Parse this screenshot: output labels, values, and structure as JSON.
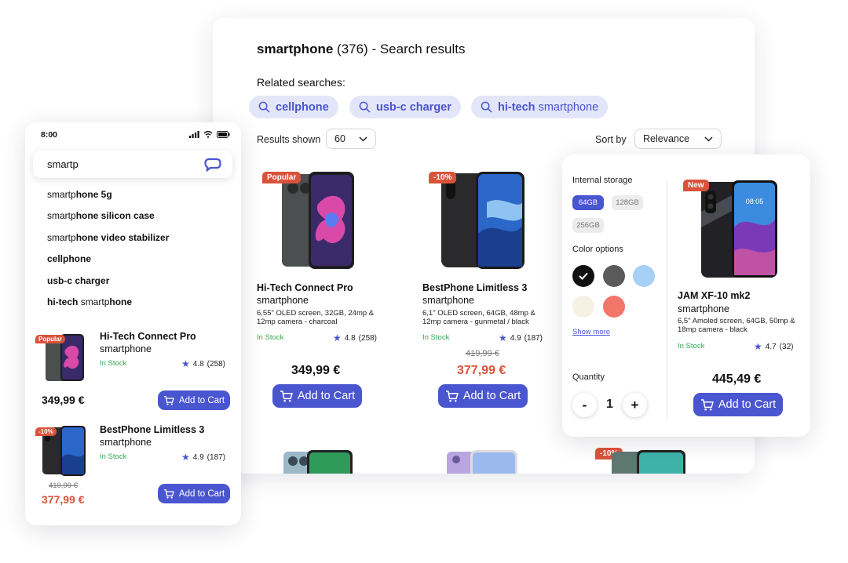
{
  "search": {
    "query": "smartphone",
    "count": "(376)",
    "suffix": "- Search results",
    "related_label": "Related searches:",
    "related": [
      {
        "query": "cellphone",
        "rest": ""
      },
      {
        "query": "usb-c charger",
        "rest": ""
      },
      {
        "query": "hi-tech",
        "rest": "smartphone"
      }
    ],
    "results_shown_label": "Results shown",
    "results_shown_value": "60",
    "sort_by_label": "Sort by",
    "sort_by_value": "Relevance"
  },
  "products": [
    {
      "badge": "Popular",
      "name": "Hi-Tech Connect Pro",
      "category": "smartphone",
      "desc": "6,55\" OLED screen, 32GB, 24mp & 12mp camera - charcoal",
      "stock": "In Stock",
      "rating": "4.8",
      "reviews": "(258)",
      "price": "349,99 €",
      "old_price": "",
      "cart_label": "Add to Cart"
    },
    {
      "badge": "-10%",
      "name": "BestPhone Limitless 3",
      "category": "smartphone",
      "desc": "6,1\" OLED screen, 64GB, 48mp & 12mp camera - gunmetal / black",
      "stock": "In Stock",
      "rating": "4.9",
      "reviews": "(187)",
      "price": "377,99 €",
      "old_price": "419,99 €",
      "cart_label": "Add to Cart"
    },
    {
      "badge": "New",
      "name": "JAM XF-10 mk2",
      "category": "smartphone",
      "desc": "6,5\" Amoled screen, 64GB, 50mp & 18mp camera - black",
      "stock": "In Stock",
      "rating": "4.7",
      "reviews": "(32)",
      "price": "445,49 €",
      "old_price": "",
      "cart_label": "Add to Cart",
      "screen_time": "08:05"
    }
  ],
  "row2_badge": "-10%",
  "mobile": {
    "time": "8:00",
    "search_value": "smartp",
    "suggestions": [
      {
        "typed": "smartp",
        "rest": "hone 5g",
        "extra": ""
      },
      {
        "typed": "smartp",
        "rest": "hone silicon case",
        "extra": ""
      },
      {
        "typed": "smartp",
        "rest": "hone video stabilizer",
        "extra": ""
      },
      {
        "typed": "",
        "rest": "cellphone",
        "extra": ""
      },
      {
        "typed": "",
        "rest": "usb-c charger",
        "extra": ""
      },
      {
        "typed": "smartp",
        "rest": "hone",
        "extra": "hi-tech"
      }
    ]
  },
  "filters": {
    "storage_label": "Internal storage",
    "storage_options": [
      "64GB",
      "128GB",
      "256GB"
    ],
    "color_label": "Color options",
    "colors": [
      "#111111",
      "#5a5a5a",
      "#a6d0f5",
      "#f6f1e3",
      "#f2766a"
    ],
    "show_more": "Show more",
    "quantity_label": "Quantity",
    "quantity_value": "1",
    "minus": "-",
    "plus": "+"
  },
  "colors": {
    "accent": "#4a55d0",
    "sale": "#d9533b",
    "in_stock": "#2fa84f",
    "chip_bg": "#e3e6f8"
  }
}
